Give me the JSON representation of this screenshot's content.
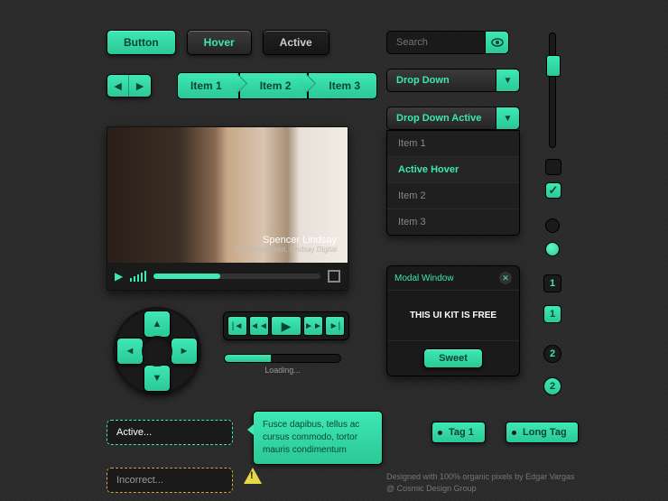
{
  "buttons": {
    "default": "Button",
    "hover": "Hover",
    "active": "Active"
  },
  "crumbs": [
    "Item 1",
    "Item 2",
    "Item 3"
  ],
  "video": {
    "caption_name": "Spencer Lindsay",
    "caption_sub": "Interactive Artist, Lindsay Digital"
  },
  "loading": "Loading...",
  "search": {
    "placeholder": "Search"
  },
  "dropdown": {
    "label": "Drop Down",
    "active_label": "Drop Down Active",
    "items": [
      "Item 1",
      "Active Hover",
      "Item 2",
      "Item 3"
    ]
  },
  "modal": {
    "title": "Modal Window",
    "body": "THIS UI KIT IS FREE",
    "button": "Sweet"
  },
  "badges": {
    "b1": "1",
    "b2": "1",
    "c1": "2",
    "c2": "2"
  },
  "inputs": {
    "active": "Active...",
    "incorrect": "Incorrect..."
  },
  "tooltip": "Fusce dapibus, tellus ac cursus commodo, tortor mauris condimentum",
  "tags": {
    "t1": "Tag 1",
    "t2": "Long Tag"
  },
  "credit": {
    "line1": "Designed with 100% organic pixels by Edgar Vargas",
    "line2": "@ Cosmic Design Group"
  },
  "colors": {
    "accent": "#3de8b4",
    "dark": "#1a1a1a"
  }
}
